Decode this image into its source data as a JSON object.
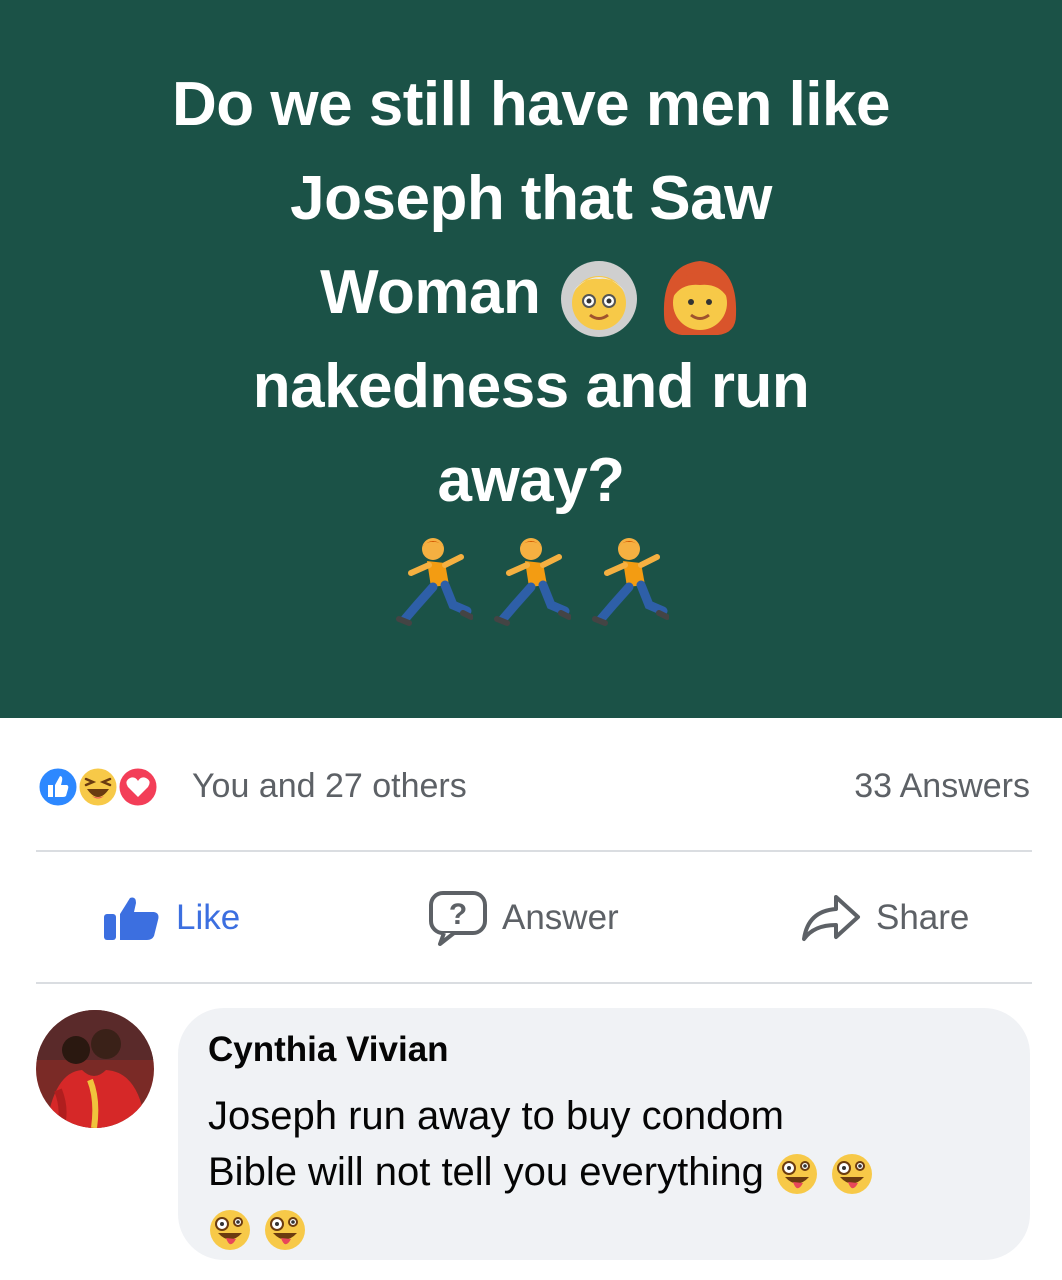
{
  "post": {
    "background_color": "#1b5247",
    "text_color": "#ffffff",
    "lines": [
      "Do we still have men like",
      "Joseph that Saw",
      "Woman",
      "nakedness and run",
      "away?"
    ],
    "emoji": {
      "after_woman": [
        "old-woman-emoji",
        "red-haired-woman-emoji"
      ],
      "runners": [
        "man-running-emoji",
        "man-running-emoji",
        "man-running-emoji"
      ]
    }
  },
  "stats": {
    "reactions": [
      "like-reaction-icon",
      "haha-reaction-icon",
      "love-reaction-icon"
    ],
    "likers_text": "You and 27 others",
    "answers_text": "33 Answers"
  },
  "actions": {
    "like_label": "Like",
    "answer_label": "Answer",
    "share_label": "Share",
    "like_color": "#3c6fe0"
  },
  "comment": {
    "author": "Cynthia Vivian",
    "lines": [
      "Joseph run away to buy condom",
      "Bible will not tell you everything"
    ],
    "emoji": [
      "zany-face-emoji",
      "zany-face-emoji",
      "zany-face-emoji",
      "zany-face-emoji"
    ],
    "bubble_color": "#f0f2f5"
  }
}
